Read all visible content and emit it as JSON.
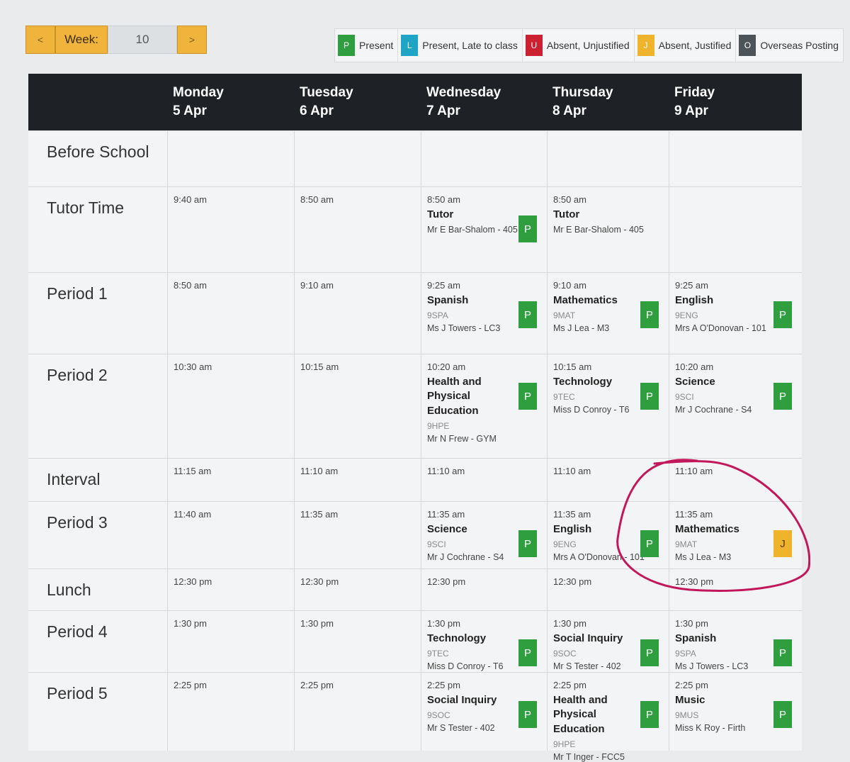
{
  "week_nav": {
    "prev": "<",
    "label": "Week:",
    "value": "10",
    "next": ">"
  },
  "legend": [
    {
      "code": "P",
      "label": "Present",
      "color": "#2e9e3e"
    },
    {
      "code": "L",
      "label": "Present, Late to class",
      "color": "#1ea4c4"
    },
    {
      "code": "U",
      "label": "Absent, Unjustified",
      "color": "#cc2130"
    },
    {
      "code": "J",
      "label": "Absent, Justified",
      "color": "#efb32c"
    },
    {
      "code": "O",
      "label": "Overseas Posting",
      "color": "#4c5359"
    }
  ],
  "days": [
    {
      "day": "Monday",
      "date": "5 Apr"
    },
    {
      "day": "Tuesday",
      "date": "6 Apr"
    },
    {
      "day": "Wednesday",
      "date": "7 Apr"
    },
    {
      "day": "Thursday",
      "date": "8 Apr"
    },
    {
      "day": "Friday",
      "date": "9 Apr"
    }
  ],
  "rows": [
    {
      "label": "Before School",
      "cells": [
        null,
        null,
        null,
        null,
        null
      ]
    },
    {
      "label": "Tutor Time",
      "cells": [
        {
          "time": "9:40 am"
        },
        {
          "time": "8:50 am"
        },
        {
          "time": "8:50 am",
          "subject": "Tutor",
          "teacher": "Mr E Bar-Shalom - 405",
          "status": "P"
        },
        {
          "time": "8:50 am",
          "subject": "Tutor",
          "teacher": "Mr E Bar-Shalom - 405"
        },
        null
      ]
    },
    {
      "label": "Period 1",
      "cells": [
        {
          "time": "8:50 am"
        },
        {
          "time": "9:10 am"
        },
        {
          "time": "9:25 am",
          "subject": "Spanish",
          "code": "9SPA",
          "teacher": "Ms J Towers - LC3",
          "status": "P"
        },
        {
          "time": "9:10 am",
          "subject": "Mathematics",
          "code": "9MAT",
          "teacher": "Ms J Lea - M3",
          "status": "P"
        },
        {
          "time": "9:25 am",
          "subject": "English",
          "code": "9ENG",
          "teacher": "Mrs A O'Donovan - 101",
          "status": "P"
        }
      ]
    },
    {
      "label": "Period 2",
      "cells": [
        {
          "time": "10:30 am"
        },
        {
          "time": "10:15 am"
        },
        {
          "time": "10:20 am",
          "subject": "Health and Physical Education",
          "code": "9HPE",
          "teacher": "Mr N Frew - GYM",
          "status": "P"
        },
        {
          "time": "10:15 am",
          "subject": "Technology",
          "code": "9TEC",
          "teacher": "Miss D Conroy - T6",
          "status": "P"
        },
        {
          "time": "10:20 am",
          "subject": "Science",
          "code": "9SCI",
          "teacher": "Mr J Cochrane - S4",
          "status": "P"
        }
      ]
    },
    {
      "label": "Interval",
      "cells": [
        {
          "time": "11:15 am"
        },
        {
          "time": "11:10 am"
        },
        {
          "time": "11:10 am"
        },
        {
          "time": "11:10 am"
        },
        {
          "time": "11:10 am"
        }
      ]
    },
    {
      "label": "Period 3",
      "cells": [
        {
          "time": "11:40 am"
        },
        {
          "time": "11:35 am"
        },
        {
          "time": "11:35 am",
          "subject": "Science",
          "code": "9SCI",
          "teacher": "Mr J Cochrane - S4",
          "status": "P"
        },
        {
          "time": "11:35 am",
          "subject": "English",
          "code": "9ENG",
          "teacher": "Mrs A O'Donovan - 101",
          "status": "P"
        },
        {
          "time": "11:35 am",
          "subject": "Mathematics",
          "code": "9MAT",
          "teacher": "Ms J Lea - M3",
          "status": "J"
        }
      ]
    },
    {
      "label": "Lunch",
      "cells": [
        {
          "time": "12:30 pm"
        },
        {
          "time": "12:30 pm"
        },
        {
          "time": "12:30 pm"
        },
        {
          "time": "12:30 pm"
        },
        {
          "time": "12:30 pm"
        }
      ]
    },
    {
      "label": "Period 4",
      "cells": [
        {
          "time": "1:30 pm"
        },
        {
          "time": "1:30 pm"
        },
        {
          "time": "1:30 pm",
          "subject": "Technology",
          "code": "9TEC",
          "teacher": "Miss D Conroy - T6",
          "status": "P"
        },
        {
          "time": "1:30 pm",
          "subject": "Social Inquiry",
          "code": "9SOC",
          "teacher": "Mr S Tester - 402",
          "status": "P"
        },
        {
          "time": "1:30 pm",
          "subject": "Spanish",
          "code": "9SPA",
          "teacher": "Ms J Towers - LC3",
          "status": "P"
        }
      ]
    },
    {
      "label": "Period 5",
      "cells": [
        {
          "time": "2:25 pm"
        },
        {
          "time": "2:25 pm"
        },
        {
          "time": "2:25 pm",
          "subject": "Social Inquiry",
          "code": "9SOC",
          "teacher": "Mr S Tester - 402",
          "status": "P"
        },
        {
          "time": "2:25 pm",
          "subject": "Health and Physical Education",
          "code": "9HPE",
          "teacher": "Mr T Inger - FCC5",
          "status": "P"
        },
        {
          "time": "2:25 pm",
          "subject": "Music",
          "code": "9MUS",
          "teacher": "Miss K Roy - Firth",
          "status": "P"
        }
      ]
    }
  ],
  "annotation": {
    "shape": "hand-drawn circle",
    "color": "#c2185b"
  }
}
